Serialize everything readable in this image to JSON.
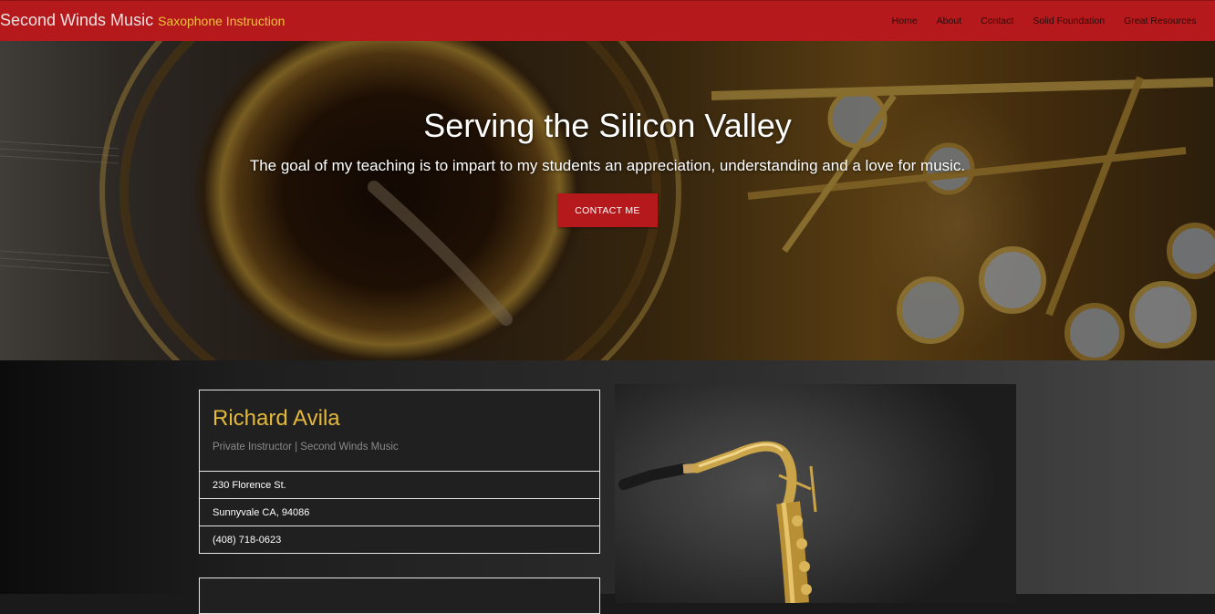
{
  "brand": {
    "name": "Second Winds Music",
    "tagline": "Saxophone Instruction"
  },
  "nav": [
    {
      "label": "Home"
    },
    {
      "label": "About"
    },
    {
      "label": "Contact"
    },
    {
      "label": "Solid Foundation"
    },
    {
      "label": "Great Resources"
    }
  ],
  "hero": {
    "title": "Serving the Silicon Valley",
    "subtitle": "The goal of my teaching is to impart to my students an appreciation, understanding and a love for music.",
    "button_label": "CONTACT ME"
  },
  "profile": {
    "name": "Richard Avila",
    "role": "Private Instructor | Second Winds Music",
    "address_line1": "230 Florence St.",
    "address_line2": "Sunnyvale CA, 94086",
    "phone": "(408) 718-0623"
  },
  "colors": {
    "brand_red": "#b5191b",
    "accent_gold": "#e3b83c",
    "tagline_gold": "#f0c23c"
  },
  "icons": {
    "hero_image": "saxophone-bell-photo",
    "profile_image": "saxophone-photo"
  }
}
